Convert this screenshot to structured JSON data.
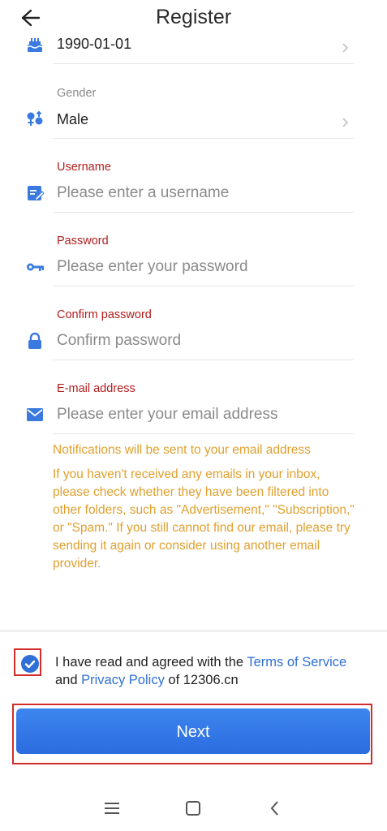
{
  "header": {
    "title": "Register"
  },
  "fields": {
    "birthday": {
      "value": "1990-01-01"
    },
    "gender": {
      "label": "Gender",
      "value": "Male"
    },
    "username": {
      "label": "Username",
      "placeholder": "Please enter a username"
    },
    "password": {
      "label": "Password",
      "placeholder": "Please enter your password"
    },
    "confirm": {
      "label": "Confirm password",
      "placeholder": "Confirm password"
    },
    "email": {
      "label": "E-mail address",
      "placeholder": "Please enter your email address"
    }
  },
  "notice": {
    "line1": "Notifications will be sent to your email address",
    "body": "If you haven't received any emails in your inbox, please check whether they have been filtered into other folders, such as \"Advertisement,\" \"Subscription,\" or \"Spam.\" If you still cannot find our email, please try sending it again or consider using another email provider."
  },
  "agreement": {
    "checked": true,
    "prefix": "I have read and agreed with the ",
    "terms": "Terms of Service",
    "and": " and ",
    "privacy": "Privacy Policy",
    "suffix": " of 12306.cn"
  },
  "next_button": {
    "label": "Next"
  },
  "colors": {
    "accent": "#2f6fd6",
    "error_label": "#b31d1d",
    "notice": "#e0a02e"
  },
  "icons": [
    "back-arrow-icon",
    "birthday-cake-icon",
    "gender-icon",
    "edit-icon",
    "key-icon",
    "lock-icon",
    "mail-icon",
    "chevron-right-icon",
    "menu-icon",
    "home-icon",
    "back-icon"
  ]
}
